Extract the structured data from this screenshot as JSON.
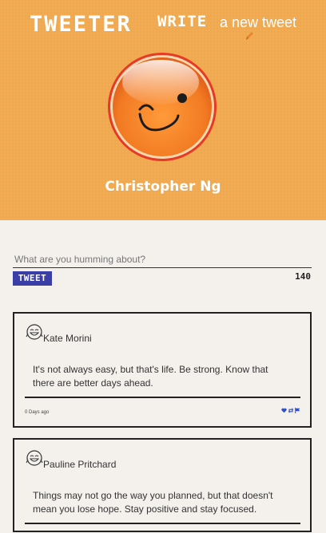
{
  "header": {
    "logo": "TWEETER",
    "write_word": "WRITE",
    "write_rest": "a new tweet"
  },
  "profile": {
    "name": "Christopher Ng"
  },
  "composer": {
    "placeholder": "What are you humming about?",
    "tweet_button": "TWEET",
    "char_count": "140"
  },
  "tweets": [
    {
      "author": "Kate Morini",
      "text": "It's not always easy, but that's life. Be strong. Know that there are better days ahead.",
      "time": "0 Days ago"
    },
    {
      "author": "Pauline Pritchard",
      "text": "Things may not go the way you planned, but that doesn't mean you lose hope. Stay positive and stay focused."
    }
  ],
  "colors": {
    "header_bg": "#f0a94f",
    "button_bg": "#3b3ea6",
    "action_blue": "#2f4fcf",
    "avatar_orange": "#f27a22"
  },
  "icons": {
    "pen": "pen-icon",
    "avatar": "wink-smiley-icon",
    "tweet_avatar": "laughing-face-icon",
    "like": "heart-icon",
    "retweet": "retweet-icon",
    "flag": "flag-icon"
  }
}
